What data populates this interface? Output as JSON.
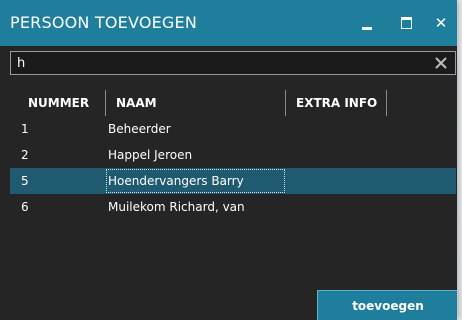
{
  "window": {
    "title": "PERSOON TOEVOEGEN",
    "controls": {
      "minimize_icon": "minimize-icon",
      "maximize_icon": "maximize-icon",
      "close_icon": "close-icon",
      "close_glyph": "✕"
    }
  },
  "search": {
    "value": "h",
    "clear_icon": "clear-icon"
  },
  "table": {
    "columns": [
      "NUMMER",
      "NAAM",
      "EXTRA INFO"
    ],
    "rows": [
      {
        "nummer": "1",
        "naam": "Beheerder",
        "extra_info": ""
      },
      {
        "nummer": "2",
        "naam": "Happel Jeroen",
        "extra_info": ""
      },
      {
        "nummer": "5",
        "naam": "Hoendervangers Barry",
        "extra_info": ""
      },
      {
        "nummer": "6",
        "naam": "Muilekom Richard, van",
        "extra_info": ""
      }
    ],
    "selected_row_index": 2
  },
  "actions": {
    "add_label": "toevoegen"
  },
  "colors": {
    "accent": "#1f7e9c",
    "selected_row": "#1f5a71",
    "window_bg": "#252526"
  }
}
